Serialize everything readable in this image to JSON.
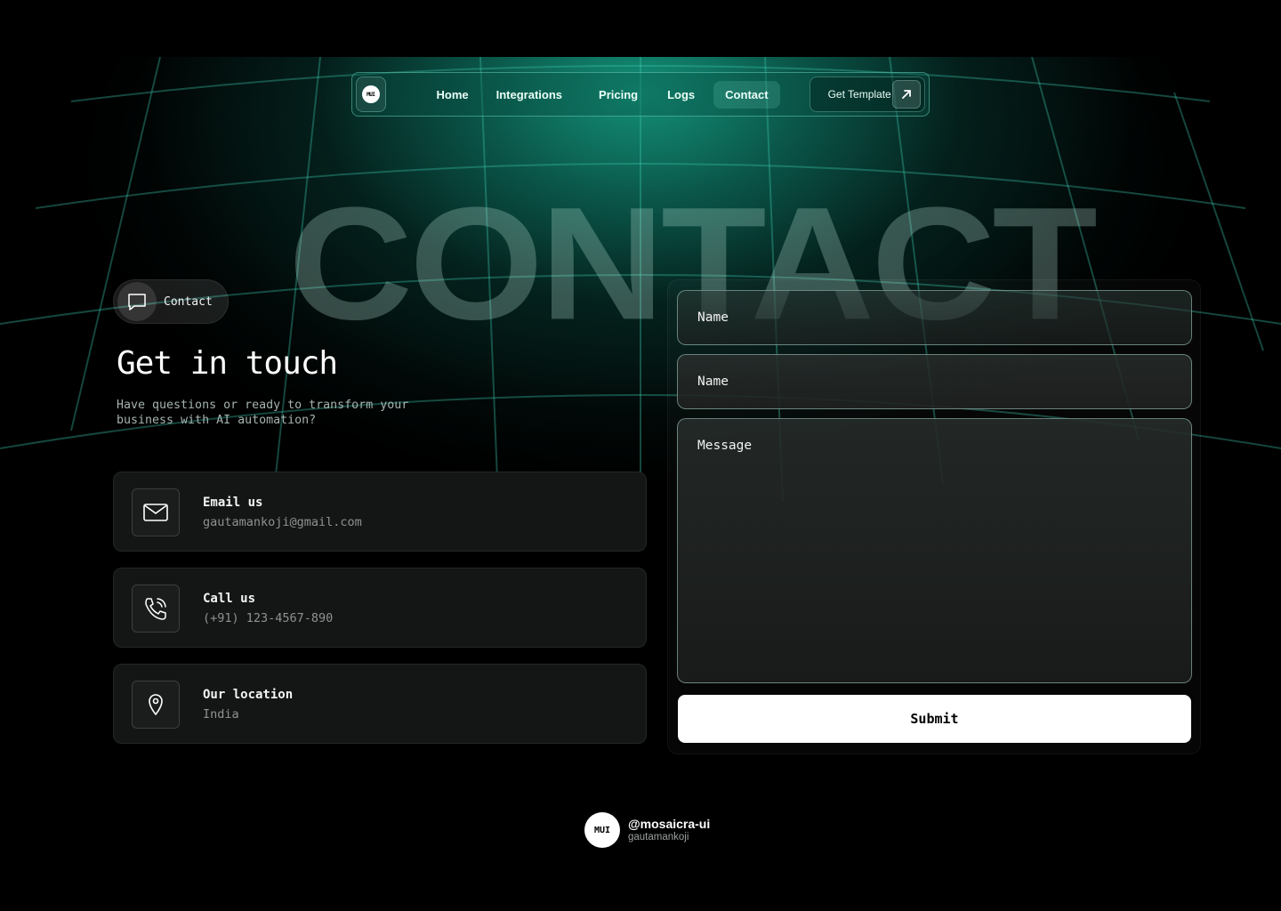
{
  "nav": {
    "logo_text": "MUI",
    "links": [
      {
        "label": "Home",
        "active": false
      },
      {
        "label": "Integrations",
        "active": false
      },
      {
        "label": "Pricing",
        "active": false
      },
      {
        "label": "Logs",
        "active": false
      },
      {
        "label": "Contact",
        "active": true
      }
    ],
    "cta_label": "Get Template",
    "cta_icon": "arrow-up-right-icon"
  },
  "hero": {
    "big_word": "CONTACT"
  },
  "left": {
    "chip_label": "Contact",
    "chip_icon": "chat-bubble-icon",
    "heading": "Get in touch",
    "subtext": "Have questions or ready to transform your business with AI automation?",
    "cards": [
      {
        "icon": "mail-icon",
        "title": "Email us",
        "value": "gautamankoji@gmail.com"
      },
      {
        "icon": "phone-icon",
        "title": "Call us",
        "value": "(+91) 123-4567-890"
      },
      {
        "icon": "map-pin-icon",
        "title": "Our location",
        "value": "India"
      }
    ]
  },
  "form": {
    "field1_label": "Name",
    "field2_label": "Name",
    "message_label": "Message",
    "submit_label": "Submit"
  },
  "footer": {
    "logo_text": "MUI",
    "handle": "@mosaicra-ui",
    "username": "gautamankoji"
  },
  "colors": {
    "accent": "#0f8f78",
    "background": "#000000",
    "card": "#141615",
    "button": "#ffffff"
  }
}
